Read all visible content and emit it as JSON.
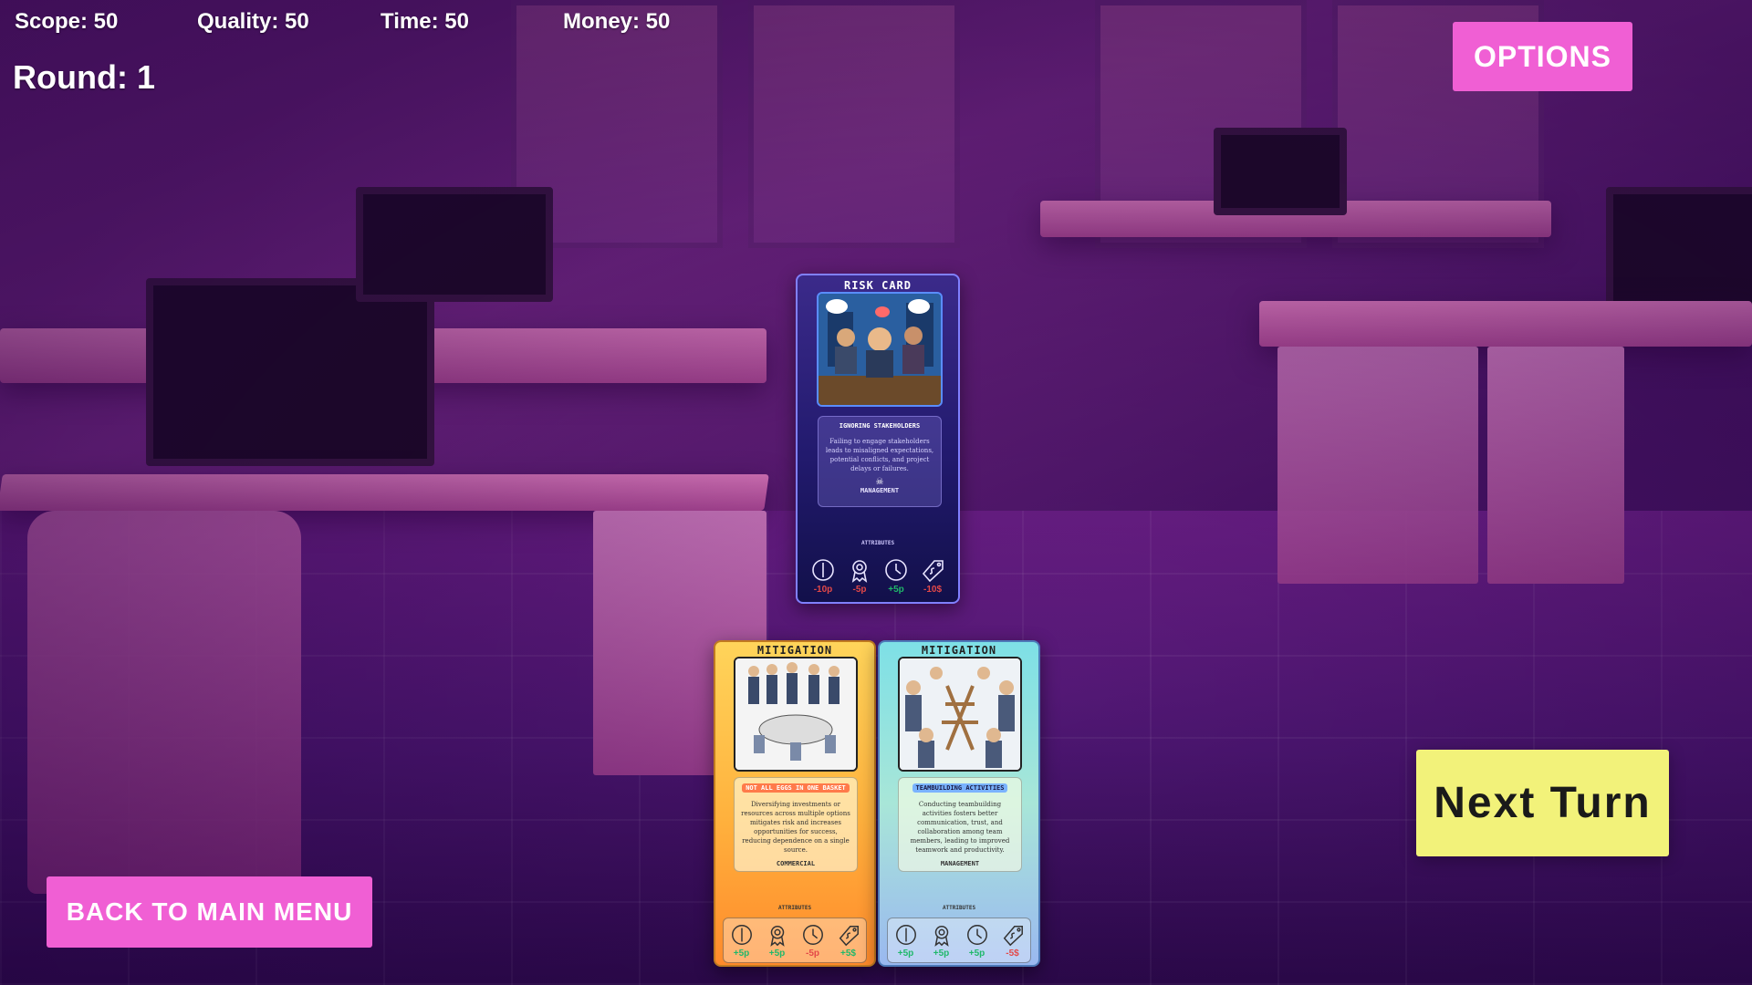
{
  "hud": {
    "scope": "Scope: 50",
    "quality": "Quality: 50",
    "time": "Time: 50",
    "money": "Money: 50",
    "round": "Round: 1"
  },
  "buttons": {
    "options": "OPTIONS",
    "back": "BACK TO MAIN MENU",
    "next_turn": "Next Turn"
  },
  "risk_card": {
    "header": "RISK CARD",
    "title": "IGNORING STAKEHOLDERS",
    "text": "Failing to engage stakeholders leads to misaligned expectations, potential conflicts, and project delays or failures.",
    "category": "MANAGEMENT",
    "attributes_label": "ATTRIBUTES",
    "attributes": [
      {
        "icon": "scope-icon",
        "value": "-10p",
        "sign": "neg"
      },
      {
        "icon": "quality-icon",
        "value": "-5p",
        "sign": "neg"
      },
      {
        "icon": "time-icon",
        "value": "+5p",
        "sign": "pos"
      },
      {
        "icon": "money-icon",
        "value": "-10$",
        "sign": "neg"
      }
    ]
  },
  "hand": [
    {
      "header": "MITIGATION",
      "title": "NOT ALL EGGS IN ONE BASKET",
      "text": "Diversifying investments or resources across multiple options mitigates risk and increases opportunities for success, reducing dependence on a single source.",
      "category": "COMMERCIAL",
      "attributes_label": "ATTRIBUTES",
      "attributes": [
        {
          "icon": "scope-icon",
          "value": "+5p",
          "sign": "pos"
        },
        {
          "icon": "quality-icon",
          "value": "+5p",
          "sign": "pos"
        },
        {
          "icon": "time-icon",
          "value": "-5p",
          "sign": "neg"
        },
        {
          "icon": "money-icon",
          "value": "+5$",
          "sign": "pos"
        }
      ]
    },
    {
      "header": "MITIGATION",
      "title": "TEAMBUILDING ACTIVITIES",
      "text": "Conducting teambuilding activities fosters better communication, trust, and collaboration among team members, leading to improved teamwork and productivity.",
      "category": "MANAGEMENT",
      "attributes_label": "ATTRIBUTES",
      "attributes": [
        {
          "icon": "scope-icon",
          "value": "+5p",
          "sign": "pos"
        },
        {
          "icon": "quality-icon",
          "value": "+5p",
          "sign": "pos"
        },
        {
          "icon": "time-icon",
          "value": "+5p",
          "sign": "pos"
        },
        {
          "icon": "money-icon",
          "value": "-5$",
          "sign": "neg"
        }
      ]
    }
  ]
}
